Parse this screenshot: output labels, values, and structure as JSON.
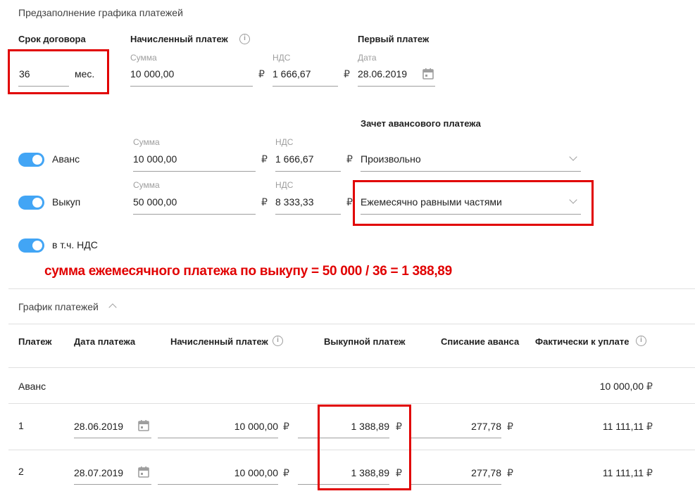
{
  "prefill": {
    "title": "Предзаполнение графика платежей",
    "term_label": "Срок договора",
    "term_value": "36",
    "term_unit": "мес.",
    "accrued_label": "Начисленный платеж",
    "amount_caption": "Сумма",
    "amount_value": "10 000,00",
    "vat_caption": "НДС",
    "vat_value": "1 666,67",
    "first_payment_label": "Первый платеж",
    "date_caption": "Дата",
    "date_value": "28.06.2019",
    "currency": "₽"
  },
  "advance_offset_label": "Зачет авансового платежа",
  "rows": {
    "advance": {
      "label": "Аванс",
      "amount_caption": "Сумма",
      "amount_value": "10 000,00",
      "vat_caption": "НДС",
      "vat_value": "1 666,67",
      "mode": "Произвольно"
    },
    "buyout": {
      "label": "Выкуп",
      "amount_caption": "Сумма",
      "amount_value": "50 000,00",
      "vat_caption": "НДС",
      "vat_value": "8 333,33",
      "mode": "Ежемесячно равными частями"
    },
    "vat_incl": {
      "label": "в т.ч. НДС"
    }
  },
  "annotation": "сумма ежемесячного платежа по выкупу = 50 000 / 36 = 1 388,89",
  "schedule": {
    "title": "График платежей",
    "headers": {
      "payment": "Платеж",
      "date": "Дата платежа",
      "accrued": "Начисленный платеж",
      "buyout": "Выкупной платеж",
      "advance_writeoff": "Списание аванса",
      "actual": "Фактически к уплате"
    },
    "advance_row": {
      "label": "Аванс",
      "actual": "10 000,00"
    },
    "rows": [
      {
        "num": "1",
        "date": "28.06.2019",
        "accrued": "10 000,00",
        "buyout": "1 388,89",
        "writeoff": "277,78",
        "actual": "11 111,11"
      },
      {
        "num": "2",
        "date": "28.07.2019",
        "accrued": "10 000,00",
        "buyout": "1 388,89",
        "writeoff": "277,78",
        "actual": "11 111,11"
      }
    ]
  },
  "colors": {
    "accent": "#42a5f5",
    "highlight": "#e10000"
  }
}
